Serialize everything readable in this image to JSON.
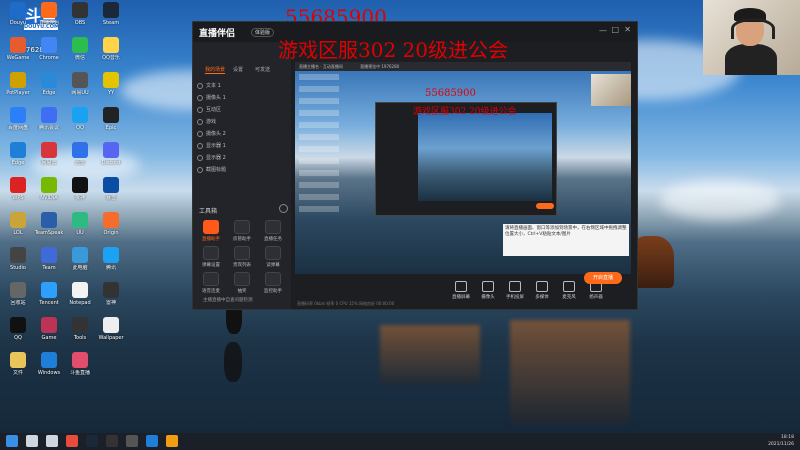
{
  "overlay": {
    "room_id": "55685900",
    "headline": "游戏区服302  20级进公会",
    "room_id_small": "55685900",
    "headline_small": "游戏区服302  20级进公会"
  },
  "top_left_logo": {
    "text": "斗鱼",
    "id": "1976280"
  },
  "desktop_icons": [
    {
      "label": "Douyu",
      "color": "#1e6bc9"
    },
    {
      "label": "直播伴侣",
      "color": "#ff6a1a"
    },
    {
      "label": "OBS",
      "color": "#333"
    },
    {
      "label": "Steam",
      "color": "#1b2838"
    },
    {
      "label": "WeGame",
      "color": "#e65c2e"
    },
    {
      "label": "Chrome",
      "color": "#4285f4"
    },
    {
      "label": "微信",
      "color": "#2dbc4e"
    },
    {
      "label": "QQ音乐",
      "color": "#ffd44a"
    },
    {
      "label": "PotPlayer",
      "color": "#d0a000"
    },
    {
      "label": "Edge",
      "color": "#2a8ad8"
    },
    {
      "label": "网易UU",
      "color": "#555"
    },
    {
      "label": "YY",
      "color": "#e2c400"
    },
    {
      "label": "百度网盘",
      "color": "#2d7ff9"
    },
    {
      "label": "腾讯会议",
      "color": "#3f6ef5"
    },
    {
      "label": "QQ",
      "color": "#1aa1f0"
    },
    {
      "label": "Epic",
      "color": "#222"
    },
    {
      "label": "Edge",
      "color": "#1f7ed8"
    },
    {
      "label": "网易云",
      "color": "#d8343c"
    },
    {
      "label": "迅雷",
      "color": "#2f71e8"
    },
    {
      "label": "Discord",
      "color": "#5865f2"
    },
    {
      "label": "WPS",
      "color": "#d22"
    },
    {
      "label": "NVIDIA",
      "color": "#76b900"
    },
    {
      "label": "夜神",
      "color": "#111"
    },
    {
      "label": "暴雪",
      "color": "#0a4da2"
    },
    {
      "label": "LOL",
      "color": "#c8a43a"
    },
    {
      "label": "TeamSpeak",
      "color": "#2a5ea8"
    },
    {
      "label": "UU",
      "color": "#2dbb83"
    },
    {
      "label": "Origin",
      "color": "#f56c2d"
    },
    {
      "label": "Studio",
      "color": "#444"
    },
    {
      "label": "Team",
      "color": "#3e6bd8"
    },
    {
      "label": "此电脑",
      "color": "#3a9ad9"
    },
    {
      "label": "腾讯",
      "color": "#1da1f2"
    },
    {
      "label": "回收站",
      "color": "#666"
    },
    {
      "label": "Tencent",
      "color": "#2da0ff"
    },
    {
      "label": "Notepad",
      "color": "#f3f3f3"
    },
    {
      "label": "雷神",
      "color": "#333"
    },
    {
      "label": "QQ",
      "color": "#111"
    },
    {
      "label": "Game",
      "color": "#b35"
    },
    {
      "label": "Tools",
      "color": "#333"
    },
    {
      "label": "Wallpaper",
      "color": "#eee"
    },
    {
      "label": "文件",
      "color": "#e8c65a"
    },
    {
      "label": "Windows",
      "color": "#1f7ed8"
    },
    {
      "label": "斗鱼直播",
      "color": "#e24d6b"
    }
  ],
  "window": {
    "app_name": "直播伴侣",
    "version_badge": "体验版",
    "tabs": [
      "我的场景",
      "设置",
      "可发送"
    ],
    "scenes": [
      "文本 1",
      "摄像头 1",
      "互动区",
      "游戏",
      "摄像头 2",
      "显示器 1",
      "显示器 2",
      "截图标题"
    ],
    "tools_title": "工具箱",
    "tools": [
      {
        "label": "直播助手",
        "hot": true
      },
      {
        "label": "房管助手",
        "hot": false
      },
      {
        "label": "直播任务",
        "hot": false
      },
      {
        "label": "弹幕设置",
        "hot": false
      },
      {
        "label": "贵宾列表",
        "hot": false
      },
      {
        "label": "读弹幕",
        "hot": false
      },
      {
        "label": "语音连麦",
        "hot": false
      },
      {
        "label": "抽奖",
        "hot": false
      },
      {
        "label": "监控助手",
        "hot": false
      }
    ],
    "footer_note": "主播直播中自查问题检测",
    "controls": [
      "直播屏幕",
      "摄像头",
      "手机投屏",
      "多媒体",
      "麦克风",
      "扬声器"
    ],
    "go_live": "开启直播",
    "status_line": "直播码率 0kb/s  帧率 0  CPU 15%  网络良好  00:00:00",
    "room_title": "直播主播名 · 互动直播间",
    "room_subtitle": "直播预览中 1976280"
  },
  "tooltip": "请将直播画面、窗口等添加到场景中，在右侧区域中拖拽调整位置大小，Ctrl+V粘贴文本/图片",
  "taskbar": {
    "icons": [
      {
        "name": "windows-icon",
        "color": "#3a8ee6"
      },
      {
        "name": "search-icon",
        "color": "#cfd6e0"
      },
      {
        "name": "task-view-icon",
        "color": "#cfd6e0"
      },
      {
        "name": "chrome-icon",
        "color": "#e74c3c"
      },
      {
        "name": "steam-icon",
        "color": "#1b2838"
      },
      {
        "name": "app-icon",
        "color": "#333"
      },
      {
        "name": "obs-icon",
        "color": "#555"
      },
      {
        "name": "edge-icon",
        "color": "#1f7ed8"
      },
      {
        "name": "douyu-icon",
        "color": "#f39c12"
      }
    ],
    "time": "18:18",
    "date": "2021/11/26"
  }
}
